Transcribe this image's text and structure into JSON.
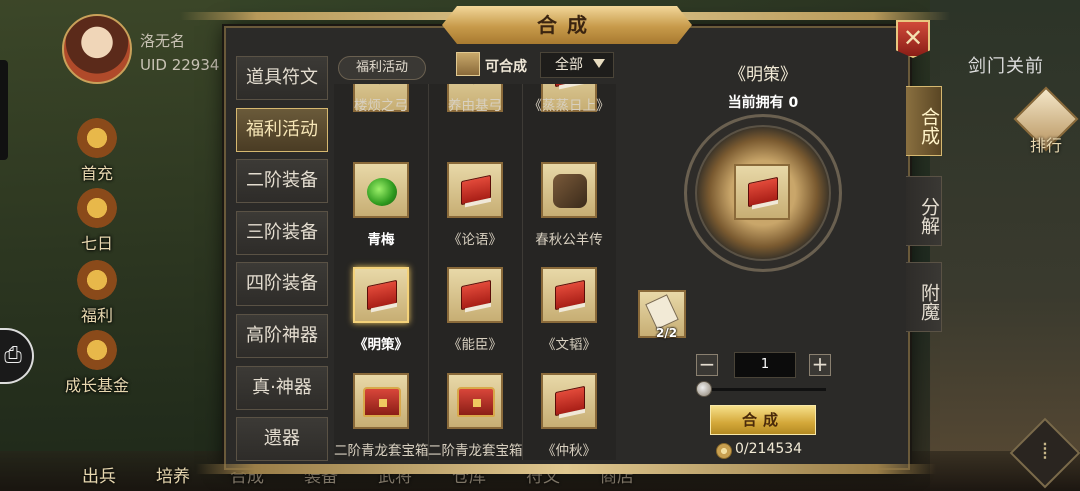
{
  "player": {
    "name": "洛无名",
    "uid": "UID  22934"
  },
  "hud_left": [
    "首充",
    "七日",
    "福利",
    "成长基金"
  ],
  "hud_right": {
    "title": "剑门关前",
    "rank": "排行"
  },
  "bottom_bar": [
    "出兵",
    "培养",
    "合成",
    "装备",
    "武将",
    "仓库",
    "符文",
    "商店"
  ],
  "dialog": {
    "title": "合成",
    "categories": [
      "道具符文",
      "福利活动",
      "二阶装备",
      "三阶装备",
      "四阶装备",
      "高阶神器",
      "真·神器",
      "遗器"
    ],
    "active_category": "福利活动",
    "filter_tag": "福利活动",
    "craftable_label": "可合成",
    "select_value": "全部",
    "items": [
      [
        "楼烦之弓",
        "养由基弓",
        "《蒸蒸日上》"
      ],
      [
        "青梅",
        "《论语》",
        "春秋公羊传"
      ],
      [
        "《明策》",
        "《能臣》",
        "《文韬》"
      ],
      [
        "二阶青龙套宝箱",
        "二阶青龙套宝箱",
        "《仲秋》"
      ]
    ],
    "selected_item": "《明策》",
    "detail": {
      "name": "《明策》",
      "owned": "当前拥有  0",
      "material_count": "2/2",
      "quantity": "1",
      "slider_fraction": 0,
      "compose_label": "合成",
      "coin_text": "0/214534"
    },
    "side_tabs": [
      "合成",
      "分解",
      "附魔"
    ],
    "active_side_tab": "合成"
  },
  "colors": {
    "accent_gold": "#d4a83a",
    "panel": "#2b2a28",
    "selected_border": "#f4d27a"
  }
}
